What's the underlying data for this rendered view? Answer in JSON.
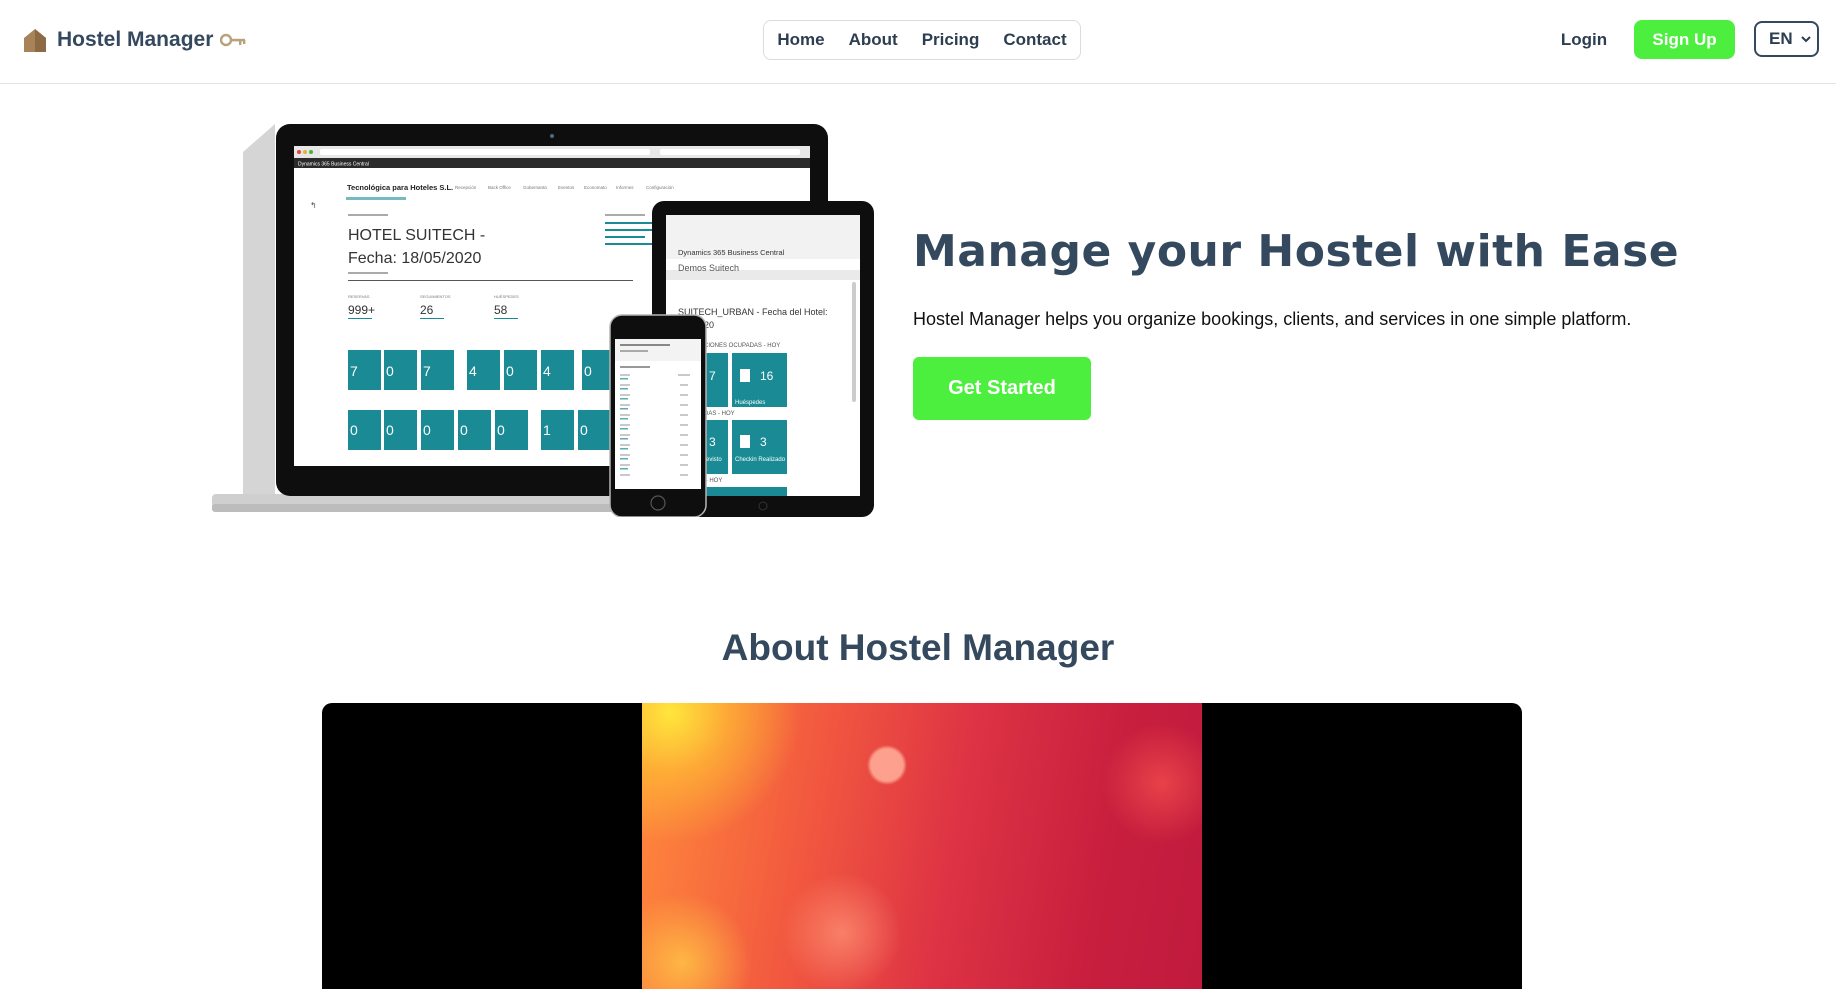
{
  "header": {
    "brand": "Hostel Manager",
    "nav": [
      "Home",
      "About",
      "Pricing",
      "Contact"
    ],
    "login": "Login",
    "signup": "Sign Up",
    "language": "EN"
  },
  "hero": {
    "title": "Manage your Hostel with Ease",
    "subtitle": "Hostel Manager helps you organize bookings, clients, and services in one simple platform.",
    "cta": "Get Started",
    "mockup": {
      "laptop_app": "Dynamics 365 Business Central",
      "company": "Tecnológica para Hoteles S.L.",
      "menu": [
        "Recepción",
        "Back Office",
        "Gobernanta",
        "Eventos",
        "Economato",
        "Informes",
        "Configuración"
      ],
      "hotel_line1": "HOTEL SUITECH  -",
      "hotel_line2": "Fecha: 18/05/2020",
      "stats": [
        {
          "label": "RESERVAS",
          "value": "999+"
        },
        {
          "label": "SEGUIMIENTOS",
          "value": "26"
        },
        {
          "label": "HUÉSPEDES",
          "value": "58"
        }
      ],
      "tiles_row1": [
        "7",
        "0",
        "7",
        "4",
        "0",
        "4",
        "0"
      ],
      "tiles_row2": [
        "0",
        "0",
        "0",
        "0",
        "0",
        "1",
        "0"
      ],
      "tablet_title": "Dynamics 365 Business Central",
      "tablet_company": "Demos Suitech",
      "tablet_hotel": "SUITECH_URBAN - Fecha del Hotel:",
      "tablet_year": "20",
      "tablet_section1": "ACIONES OCUPADAS - HOY",
      "tablet_tiles1": [
        {
          "value": "7",
          "label": "as"
        },
        {
          "value": "16",
          "label": "Huéspedes"
        }
      ],
      "tablet_section2": "ADAS - HOY",
      "tablet_tiles2": [
        {
          "value": "3",
          "label": "Previsto"
        },
        {
          "value": "3",
          "label": "Checkin Realizado - Hoy"
        }
      ],
      "tablet_section3": "S - HOY"
    }
  },
  "about": {
    "title": "About Hostel Manager"
  },
  "colors": {
    "primary_green": "#4cef3e",
    "heading": "#34495e",
    "tile_teal": "#1a8a94"
  },
  "icons": {
    "brand": "house-icon",
    "brand_suffix": "key-icon",
    "language": "chevron-down-icon"
  }
}
